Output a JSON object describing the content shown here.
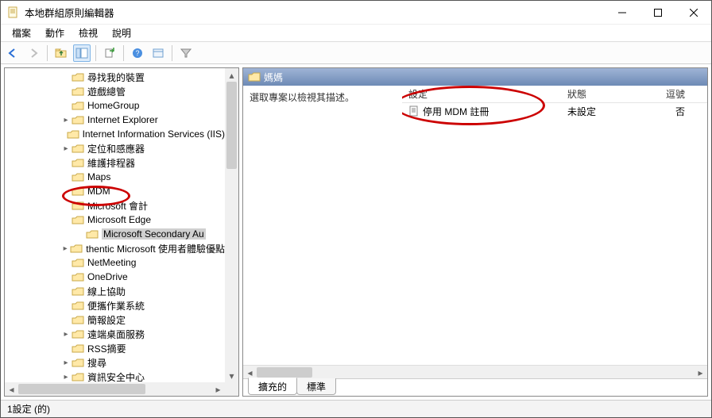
{
  "window": {
    "title": "本地群組原則編輯器"
  },
  "menubar": {
    "items": [
      "檔案",
      "動作",
      "檢視",
      "說明"
    ]
  },
  "tree": {
    "items": [
      {
        "label": "尋找我的裝置",
        "depth": 1,
        "expander": ""
      },
      {
        "label": "遊戲總管",
        "depth": 1,
        "expander": ""
      },
      {
        "label": "HomeGroup",
        "depth": 1,
        "expander": ""
      },
      {
        "label": "Internet Explorer",
        "depth": 1,
        "expander": ">"
      },
      {
        "label": "Internet Information Services (IIS)",
        "depth": 1,
        "expander": ""
      },
      {
        "label": "定位和感應器",
        "depth": 1,
        "expander": ">"
      },
      {
        "label": "維護排程器",
        "depth": 1,
        "expander": ""
      },
      {
        "label": "Maps",
        "depth": 1,
        "expander": ""
      },
      {
        "label": "MDM",
        "depth": 1,
        "expander": "",
        "circled": true
      },
      {
        "label": "Microsoft 會計",
        "depth": 1,
        "expander": ""
      },
      {
        "label": "Microsoft Edge",
        "depth": 1,
        "expander": ""
      },
      {
        "label": "Microsoft Secondary Au",
        "depth": 2,
        "expander": "",
        "selected": true
      },
      {
        "label": "thentic Microsoft 使用者體驗優點",
        "depth": 1,
        "expander": ">"
      },
      {
        "label": "NetMeeting",
        "depth": 1,
        "expander": ""
      },
      {
        "label": "OneDrive",
        "depth": 1,
        "expander": ""
      },
      {
        "label": "線上協助",
        "depth": 1,
        "expander": ""
      },
      {
        "label": "便攜作業系統",
        "depth": 1,
        "expander": ""
      },
      {
        "label": "簡報設定",
        "depth": 1,
        "expander": ""
      },
      {
        "label": "遠端桌面服務",
        "depth": 1,
        "expander": ">"
      },
      {
        "label": "RSS摘要",
        "depth": 1,
        "expander": ""
      },
      {
        "label": "搜尋",
        "depth": 1,
        "expander": ">"
      },
      {
        "label": "資訊安全中心",
        "depth": 1,
        "expander": ">"
      }
    ]
  },
  "detail": {
    "header": "媽媽",
    "hint": "選取專案以檢視其描述。",
    "columns": {
      "c1": "設定",
      "c2": "狀態",
      "c3": "逗號"
    },
    "rows": [
      {
        "name": "停用 MDM 註冊",
        "state": "未設定",
        "comma": "否",
        "circled": true
      }
    ]
  },
  "tabs": {
    "items": [
      "擴充的",
      "標準"
    ],
    "active": 0
  },
  "statusbar": {
    "text": "1設定 (的)"
  }
}
